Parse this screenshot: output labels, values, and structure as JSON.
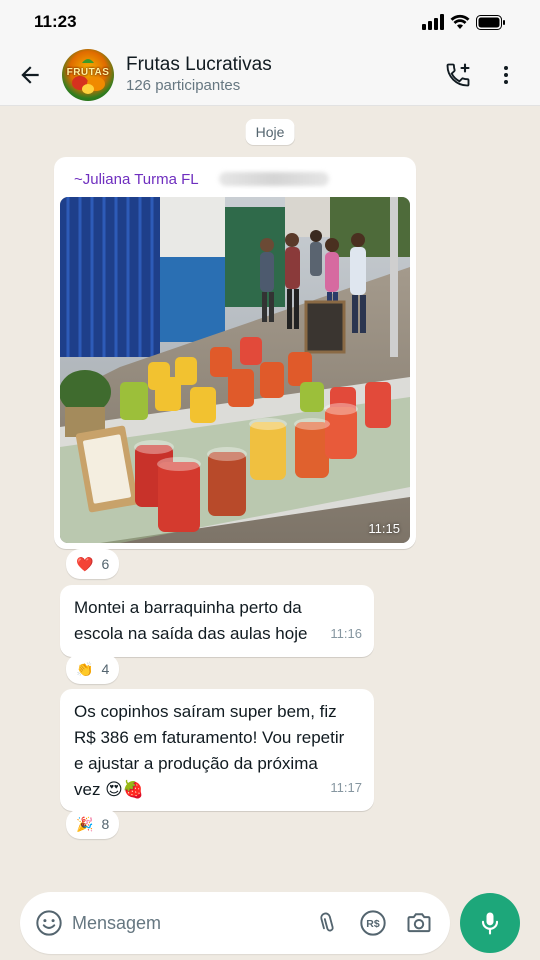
{
  "status_bar": {
    "time": "11:23"
  },
  "header": {
    "group_name": "Frutas Lucrativas",
    "participants": "126 participantes",
    "avatar_text": "FRUTAS"
  },
  "chat": {
    "date_divider": "Hoje",
    "messages": [
      {
        "sender": "~Juliana Turma FL",
        "type": "image",
        "time": "11:15",
        "reaction": {
          "emoji": "❤️",
          "count": "6"
        }
      },
      {
        "type": "text",
        "text_line1": "Montei a barraquinha perto da",
        "text_line2": "escola na saída das aulas hoje",
        "time": "11:16",
        "reaction": {
          "emoji": "👏",
          "count": "4"
        }
      },
      {
        "type": "text",
        "text_line1": "Os copinhos saíram super bem, fiz",
        "text_line2": "R$ 386 em faturamento! Vou repetir",
        "text_line3": "e ajustar a produção da próxima",
        "text_line4": "vez 😍🍓",
        "time": "11:17",
        "reaction": {
          "emoji": "🎉",
          "count": "8"
        }
      }
    ]
  },
  "input": {
    "placeholder": "Mensagem"
  },
  "icons": [
    "back-arrow-icon",
    "add-call-icon",
    "more-vert-icon",
    "emoji-icon",
    "attach-icon",
    "payment-icon",
    "camera-icon",
    "mic-icon"
  ],
  "colors": {
    "accent": "#1da77a",
    "sender": "#6f2fbf",
    "chat_bg": "#efeae2"
  }
}
